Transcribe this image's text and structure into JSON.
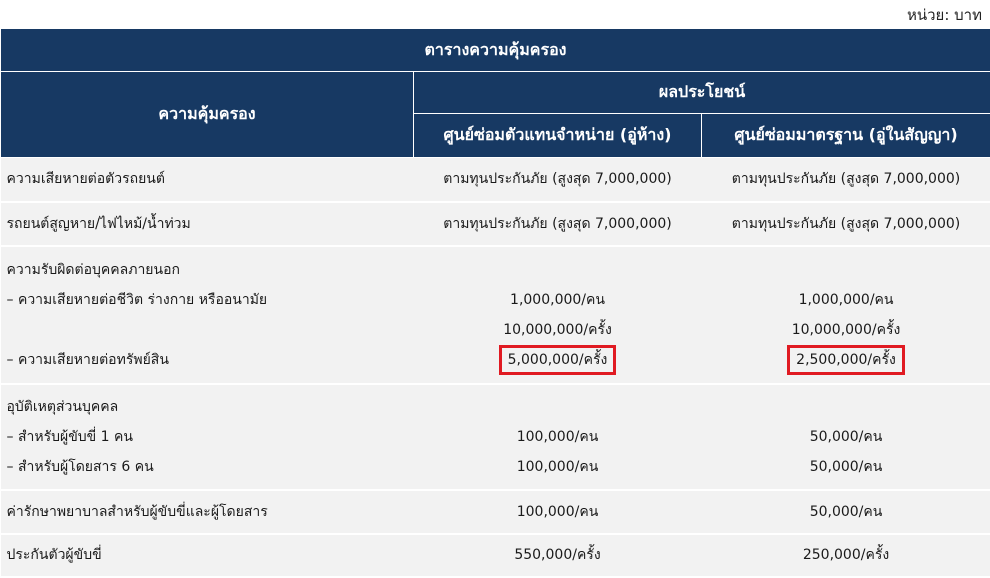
{
  "unit_label": "หน่วย: บาท",
  "header": {
    "table_title": "ตารางความคุ้มครอง",
    "coverage_label": "ความคุ้มครอง",
    "benefit_label": "ผลประโยชน์",
    "col_dealer": "ศูนย์ซ่อมตัวแทนจำหน่าย (อู่ห้าง)",
    "col_standard": "ศูนย์ซ่อมมาตรฐาน (อู่ในสัญญา)"
  },
  "rows": {
    "vehicle_damage": {
      "label": "ความเสียหายต่อตัวรถยนต์",
      "dealer": "ตามทุนประกันภัย (สูงสุด 7,000,000)",
      "standard": "ตามทุนประกันภัย (สูงสุด 7,000,000)"
    },
    "loss_fire_flood": {
      "label": "รถยนต์สูญหาย/ไฟไหม้/น้ำท่วม",
      "dealer": "ตามทุนประกันภัย (สูงสุด 7,000,000)",
      "standard": "ตามทุนประกันภัย (สูงสุด 7,000,000)"
    },
    "third_party": {
      "title": "ความรับผิดต่อบุคคลภายนอก",
      "life_label": "– ความเสียหายต่อชีวิต ร่างกาย หรืออนามัย",
      "life_dealer_person": "1,000,000/คน",
      "life_standard_person": "1,000,000/คน",
      "life_dealer_time": "10,000,000/ครั้ง",
      "life_standard_time": "10,000,000/ครั้ง",
      "property_label": "– ความเสียหายต่อทรัพย์สิน",
      "property_dealer": "5,000,000/ครั้ง",
      "property_standard": "2,500,000/ครั้ง"
    },
    "personal_accident": {
      "title": "อุบัติเหตุส่วนบุคคล",
      "driver_label": "– สำหรับผู้ขับขี่ 1 คน",
      "driver_dealer": "100,000/คน",
      "driver_standard": "50,000/คน",
      "passenger_label": "– สำหรับผู้โดยสาร 6 คน",
      "passenger_dealer": "100,000/คน",
      "passenger_standard": "50,000/คน"
    },
    "medical": {
      "label": "ค่ารักษาพยาบาลสำหรับผู้ขับขี่และผู้โดยสาร",
      "dealer": "100,000/คน",
      "standard": "50,000/คน"
    },
    "bail": {
      "label": "ประกันตัวผู้ขับขี่",
      "dealer": "550,000/ครั้ง",
      "standard": "250,000/ครั้ง"
    }
  },
  "colors": {
    "header_bg": "#173963",
    "row_bg": "#f2f2f2",
    "highlight_border": "#e01a22"
  }
}
